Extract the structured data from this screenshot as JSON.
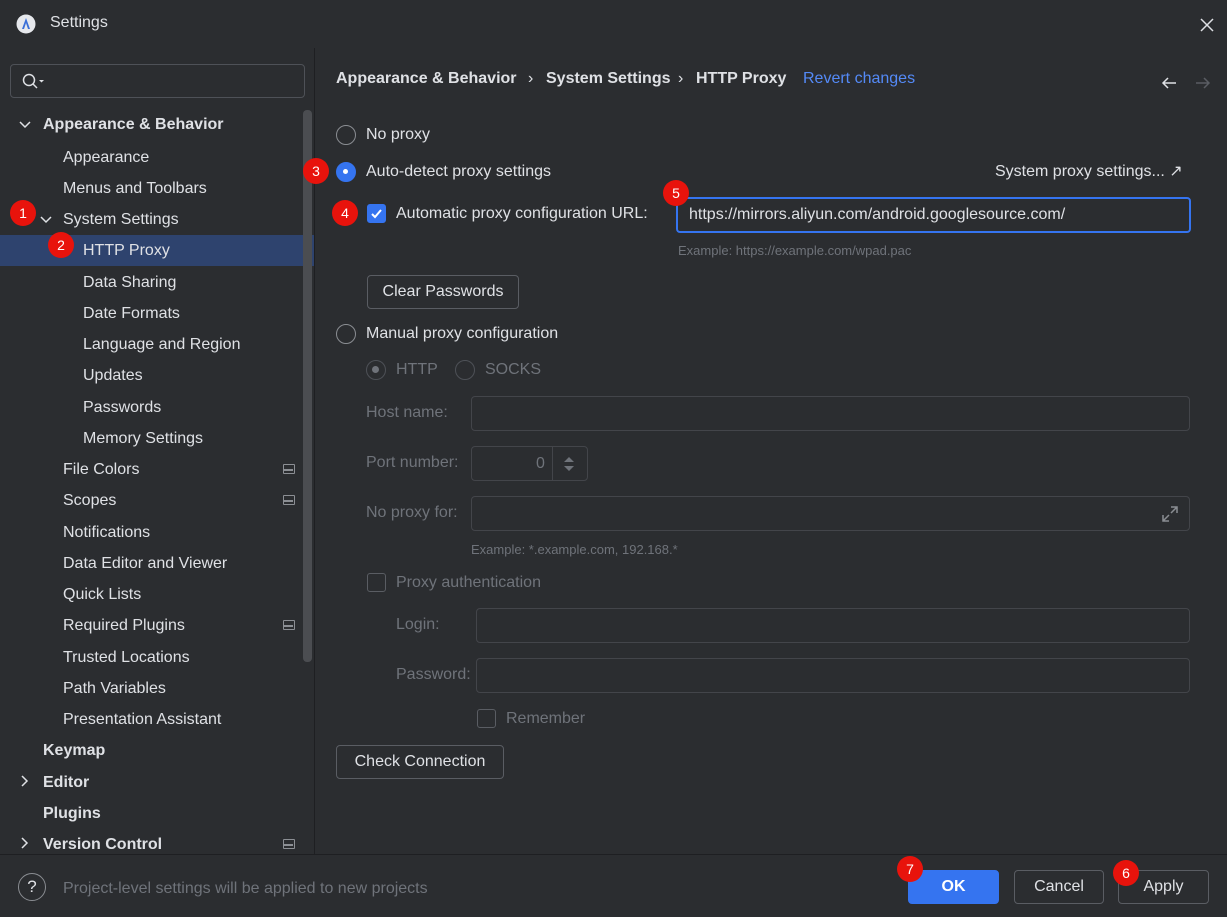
{
  "window": {
    "title": "Settings"
  },
  "search": {
    "placeholder": ""
  },
  "sidebar": {
    "items": [
      {
        "label": "Appearance & Behavior"
      },
      {
        "label": "Appearance"
      },
      {
        "label": "Menus and Toolbars"
      },
      {
        "label": "System Settings"
      },
      {
        "label": "HTTP Proxy"
      },
      {
        "label": "Data Sharing"
      },
      {
        "label": "Date Formats"
      },
      {
        "label": "Language and Region"
      },
      {
        "label": "Updates"
      },
      {
        "label": "Passwords"
      },
      {
        "label": "Memory Settings"
      },
      {
        "label": "File Colors"
      },
      {
        "label": "Scopes"
      },
      {
        "label": "Notifications"
      },
      {
        "label": "Data Editor and Viewer"
      },
      {
        "label": "Quick Lists"
      },
      {
        "label": "Required Plugins"
      },
      {
        "label": "Trusted Locations"
      },
      {
        "label": "Path Variables"
      },
      {
        "label": "Presentation Assistant"
      },
      {
        "label": "Keymap"
      },
      {
        "label": "Editor"
      },
      {
        "label": "Plugins"
      },
      {
        "label": "Version Control"
      }
    ]
  },
  "breadcrumb": {
    "items": [
      "Appearance & Behavior",
      "System Settings",
      "HTTP Proxy"
    ],
    "separator": "›",
    "revert": "Revert changes"
  },
  "proxy": {
    "no_proxy": "No proxy",
    "auto_detect": "Auto-detect proxy settings",
    "system_settings_link": "System proxy settings... ↗",
    "auto_url_label": "Automatic proxy configuration URL:",
    "auto_url_value": "https://mirrors.aliyun.com/android.googlesource.com/",
    "auto_url_example": "Example: https://example.com/wpad.pac",
    "clear_passwords": "Clear Passwords",
    "manual": "Manual proxy configuration",
    "http": "HTTP",
    "socks": "SOCKS",
    "host_label": "Host name:",
    "port_label": "Port number:",
    "port_value": "0",
    "no_proxy_for_label": "No proxy for:",
    "no_proxy_example": "Example: *.example.com, 192.168.*",
    "proxy_auth": "Proxy authentication",
    "login_label": "Login:",
    "password_label": "Password:",
    "remember": "Remember",
    "check_connection": "Check Connection"
  },
  "footer": {
    "help": "?",
    "note": "Project-level settings will be applied to new projects",
    "ok": "OK",
    "cancel": "Cancel",
    "apply": "Apply"
  },
  "badges": [
    "1",
    "2",
    "3",
    "4",
    "5",
    "6",
    "7"
  ],
  "colors": {
    "accent": "#3574f0",
    "badge": "#e8130c",
    "selection": "#2e436e",
    "link": "#548af7"
  }
}
